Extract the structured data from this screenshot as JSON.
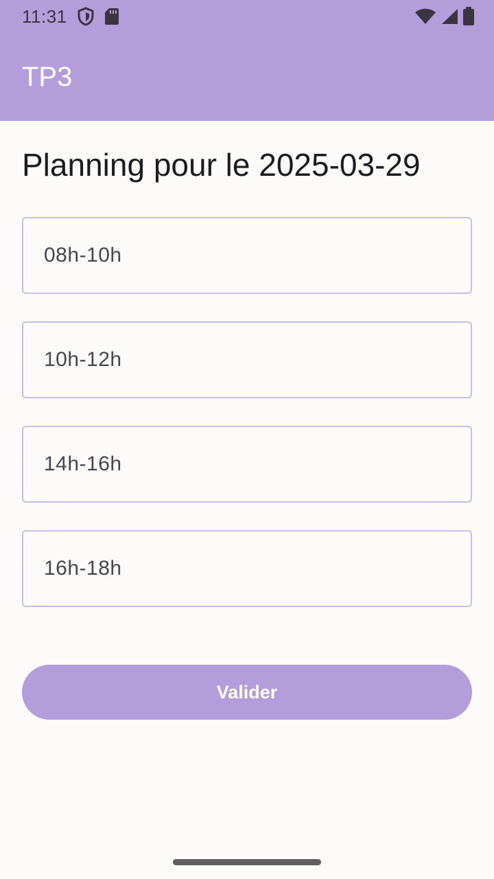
{
  "status_bar": {
    "time": "11:31",
    "icons_left": [
      "shield-icon",
      "sd-card-icon"
    ],
    "icons_right": [
      "wifi-icon",
      "cell-signal-icon",
      "battery-icon"
    ]
  },
  "app_bar": {
    "title": "TP3"
  },
  "main": {
    "title": "Planning pour le 2025-03-29",
    "slots": [
      {
        "value": "08h-10h"
      },
      {
        "value": "10h-12h"
      },
      {
        "value": "14h-16h"
      },
      {
        "value": "16h-18h"
      }
    ],
    "validate_label": "Valider"
  },
  "colors": {
    "accent": "#b39ddb",
    "field_border": "#c8bde3",
    "background": "#fdfbf9",
    "text_primary": "#1c1b1f"
  }
}
